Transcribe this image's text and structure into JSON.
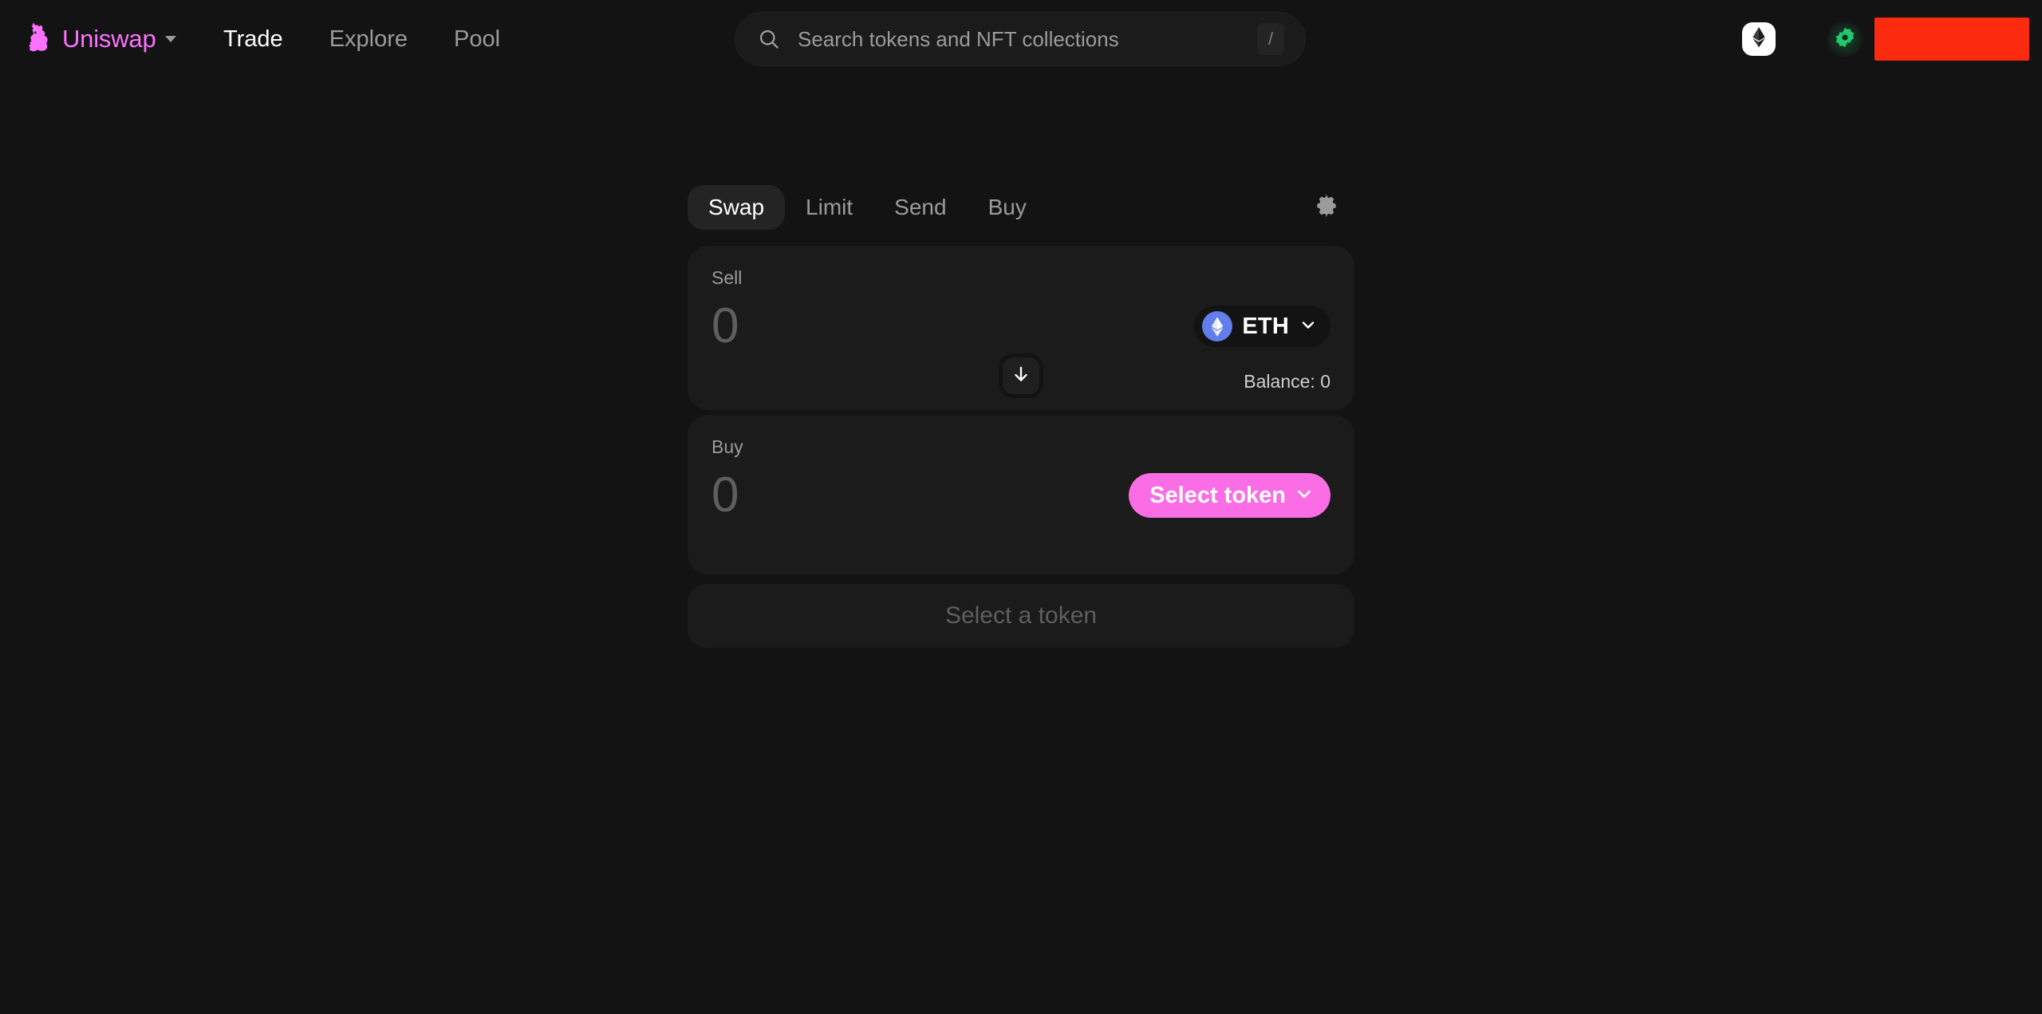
{
  "header": {
    "brand": {
      "name": "Uniswap",
      "logo_icon": "unicorn-logo",
      "caret_icon": "caret-down-icon",
      "color": "#FC72FF"
    },
    "nav": [
      {
        "label": "Trade",
        "active": true
      },
      {
        "label": "Explore",
        "active": false
      },
      {
        "label": "Pool",
        "active": false
      }
    ],
    "search": {
      "placeholder": "Search tokens and NFT collections",
      "icon": "search-icon",
      "shortcut_key": "/"
    },
    "network_chip": {
      "icon": "ethereum-icon",
      "background": "#FFFFFF"
    },
    "wallet_status": {
      "icon": "wallet-connected-icon",
      "color": "#21BE6A"
    },
    "wallet_address": {
      "redacted": true,
      "color": "#FC2A0E"
    }
  },
  "swap": {
    "tabs": [
      {
        "label": "Swap",
        "active": true
      },
      {
        "label": "Limit",
        "active": false
      },
      {
        "label": "Send",
        "active": false
      },
      {
        "label": "Buy",
        "active": false
      }
    ],
    "settings_icon": "gear-icon",
    "sell": {
      "label": "Sell",
      "amount": "0",
      "token": {
        "symbol": "ETH",
        "icon": "ethereum-icon",
        "color": "#627EEA"
      },
      "chevron_icon": "chevron-down-icon",
      "balance": "Balance: 0"
    },
    "switch_button": {
      "icon": "arrow-down-icon"
    },
    "buy": {
      "label": "Buy",
      "amount": "0",
      "select_token_label": "Select token",
      "chevron_icon": "chevron-down-icon",
      "button_color": "#FB6DE4"
    },
    "cta": {
      "label": "Select a token",
      "disabled": true
    }
  }
}
